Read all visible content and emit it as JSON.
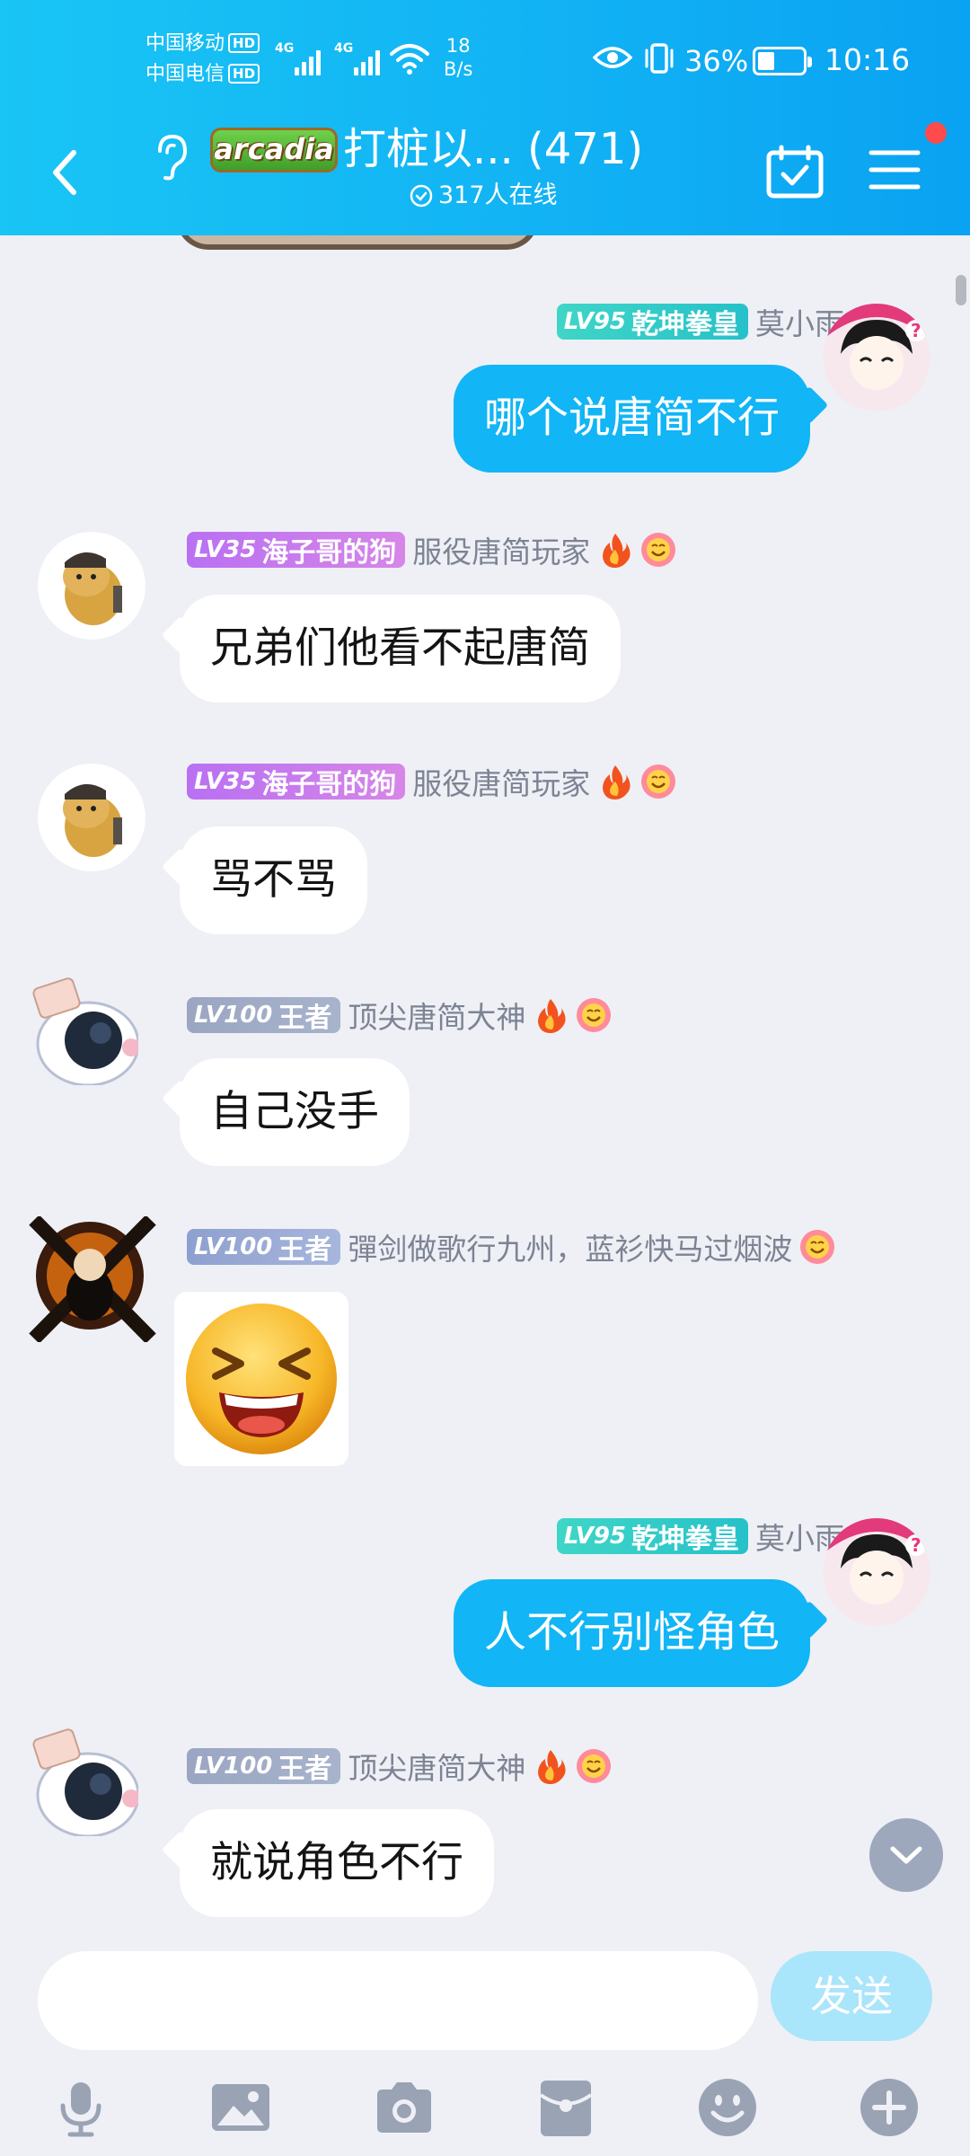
{
  "status_bar": {
    "carrier1": "中国移动",
    "carrier2": "中国电信",
    "hd": "HD",
    "net1": "4G",
    "net2": "4G",
    "speed_value": "18",
    "speed_unit": "B/s",
    "battery": "36%",
    "time": "10:16"
  },
  "header": {
    "badge": "arcadia",
    "title": "打桩以... (471)",
    "online": "317人在线"
  },
  "messages": [
    {
      "dir": "out",
      "level": "LV95",
      "title": "乾坤拳皇",
      "nick": "莫小雨",
      "text": "哪个说唐简不行"
    },
    {
      "dir": "in",
      "level": "LV35",
      "title": "海子哥的狗",
      "nick": "服役唐简玩家",
      "text": "兄弟们他看不起唐简"
    },
    {
      "dir": "in",
      "level": "LV35",
      "title": "海子哥的狗",
      "nick": "服役唐简玩家",
      "text": "骂不骂"
    },
    {
      "dir": "in",
      "level": "LV100",
      "title": "王者",
      "nick": "顶尖唐简大神",
      "text": "自己没手"
    },
    {
      "dir": "in",
      "level": "LV100",
      "title": "王者",
      "nick": "彈剑做歌行九州，蓝衫快马过烟波",
      "text": ""
    },
    {
      "dir": "out",
      "level": "LV95",
      "title": "乾坤拳皇",
      "nick": "莫小雨",
      "text": "人不行别怪角色"
    },
    {
      "dir": "in",
      "level": "LV100",
      "title": "王者",
      "nick": "顶尖唐简大神",
      "text": "就说角色不行"
    }
  ],
  "composer": {
    "placeholder": "",
    "send_label": "发送"
  },
  "colors": {
    "header": "#12b3f4",
    "bubble_out": "#12b5f5",
    "send_disabled": "#a9e5fb",
    "background": "#eef0f6"
  }
}
